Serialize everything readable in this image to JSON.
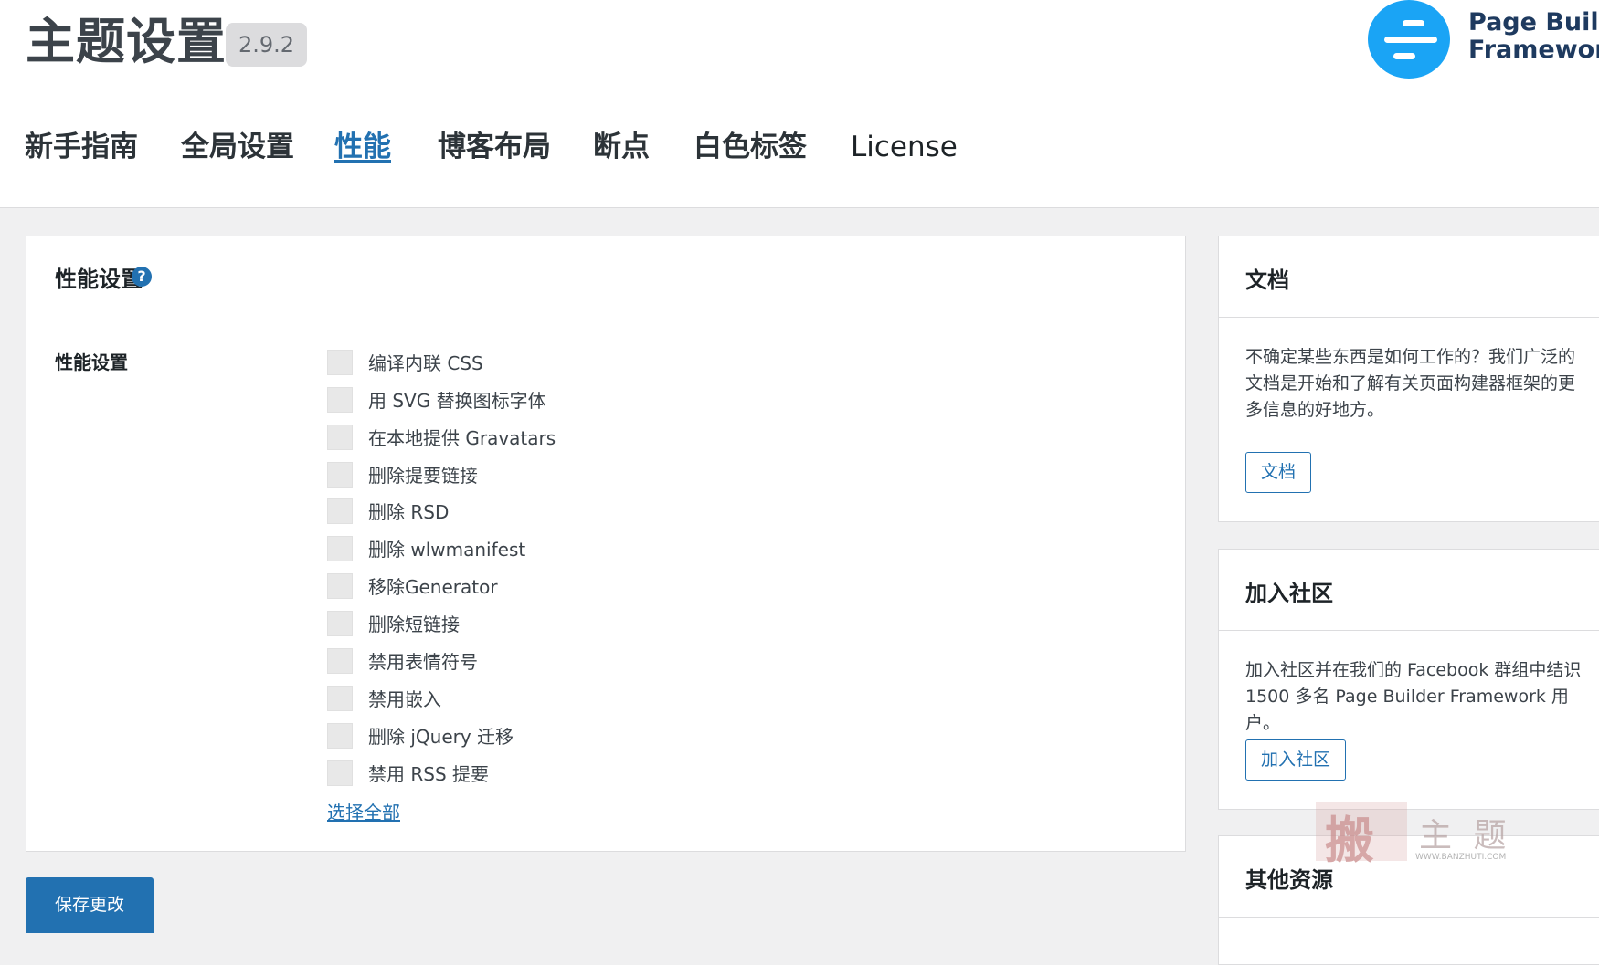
{
  "header": {
    "title": "主题设置",
    "version": "2.9.2",
    "logo_line1": "Page Builder",
    "logo_line2": "Framework"
  },
  "tabs": [
    "新手指南",
    "全局设置",
    "性能",
    "博客布局",
    "断点",
    "白色标签",
    "License"
  ],
  "active_tab": "性能",
  "main": {
    "card_title": "性能设置",
    "help_icon": "?",
    "row_label": "性能设置",
    "options": [
      "编译内联 CSS",
      "用 SVG 替换图标字体",
      "在本地提供 Gravatars",
      "删除提要链接",
      "删除 RSD",
      "删除 wlwmanifest",
      "移除Generator",
      "删除短链接",
      "禁用表情符号",
      "禁用嵌入",
      "删除 jQuery 迁移",
      "禁用 RSS 提要"
    ],
    "select_all": "选择全部",
    "save": "保存更改"
  },
  "sidebar": {
    "docs": {
      "title": "文档",
      "text": "不确定某些东西是如何工作的？我们广泛的文档是开始和了解有关页面构建器框架的更多信息的好地方。",
      "button": "文档"
    },
    "community": {
      "title": "加入社区",
      "text": "加入社区并在我们的 Facebook 群组中结识 1500 多名 Page Builder Framework 用户。",
      "button": "加入社区"
    },
    "resources": {
      "title": "其他资源"
    }
  },
  "watermark": {
    "chars": "搬",
    "text": "主 题",
    "url": "WWW.BANZHUTI.COM"
  },
  "colors": {
    "accent": "#2271b1",
    "logo": "#1aa4f5",
    "background": "#f0f0f1"
  }
}
